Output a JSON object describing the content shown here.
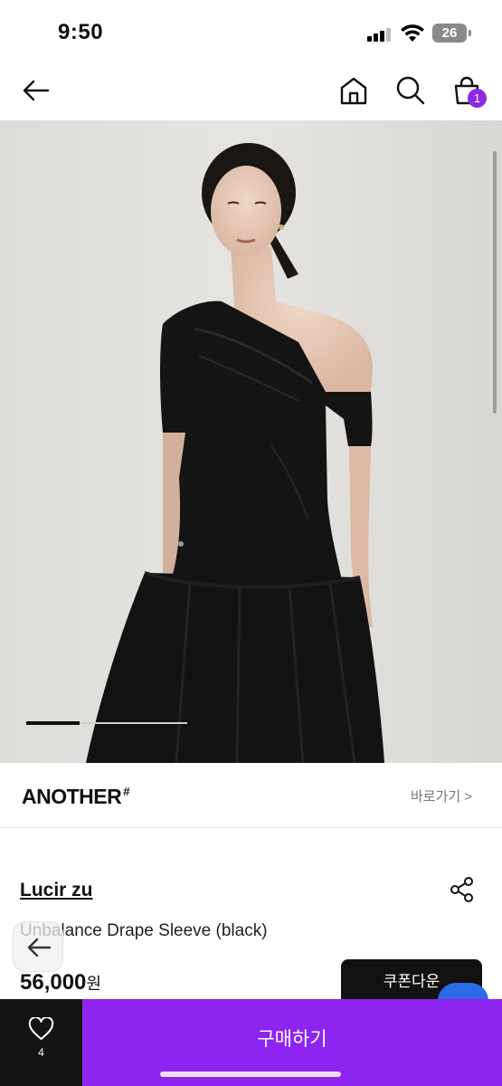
{
  "status_bar": {
    "time": "9:50",
    "battery": "26",
    "icons": [
      "signal-icon",
      "wifi-icon",
      "battery-icon"
    ]
  },
  "nav": {
    "icons": [
      "back-arrow-icon",
      "home-icon",
      "search-icon",
      "shopping-bag-icon"
    ],
    "cart_count": "1"
  },
  "carousel": {
    "progress": 0.33,
    "image_alt": "model wearing black one-shoulder drape top and black skirt"
  },
  "brand_row": {
    "name": "ANOTHER",
    "mark": "#",
    "link": "바로가기 >"
  },
  "product": {
    "brand": "Lucir zu",
    "title": "Unbalance Drape Sleeve (black)",
    "price": "56,000",
    "currency": "원",
    "coupon_label": "쿠폰다운"
  },
  "bottom_bar": {
    "like_count": "4",
    "buy_label": "구매하기"
  },
  "colors": {
    "accent": "#8e24f0",
    "badge": "#8a2be2",
    "dark": "#141414",
    "chat": "#2c6ae8"
  }
}
